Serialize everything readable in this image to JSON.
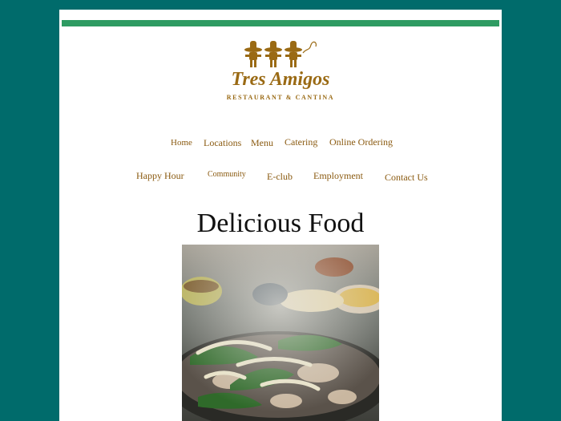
{
  "brand": {
    "logo_text": "Tres Amigos",
    "logo_subtitle": "RESTAURANT & CANTINA",
    "accent_color": "#2e9b62",
    "link_color": "#8a5a10",
    "background_color": "#006b6b"
  },
  "nav": {
    "row1": [
      "Home",
      "Locations",
      "Menu",
      "Catering",
      "Online Ordering"
    ],
    "row2": [
      "Happy Hour",
      "Community",
      "E-club",
      "Employment",
      "Contact Us"
    ]
  },
  "main": {
    "heading": "Delicious Food",
    "photo_alt": "Sizzling fajitas with grilled peppers and onions"
  }
}
